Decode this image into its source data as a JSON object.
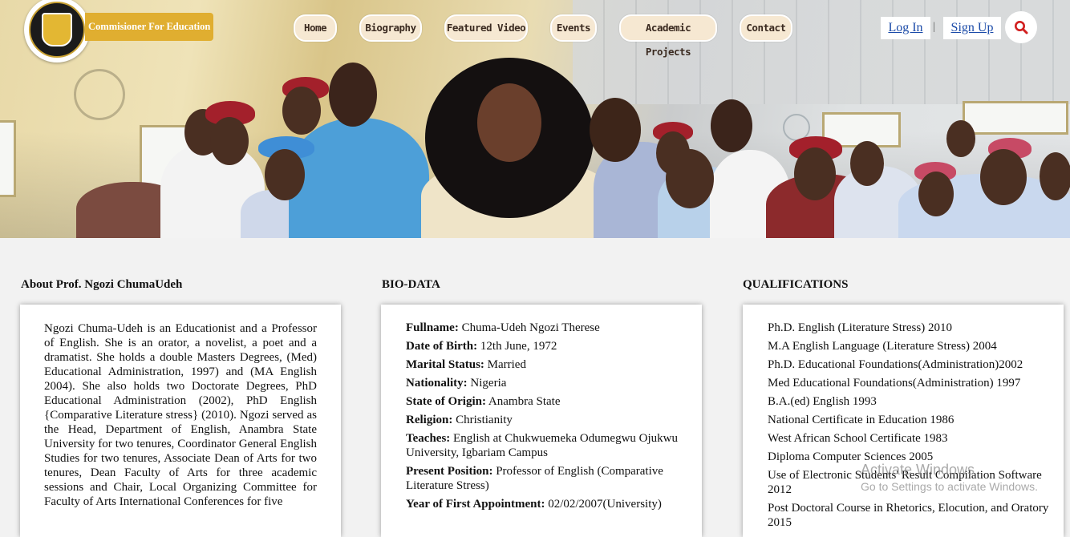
{
  "header": {
    "brand": "Commisioner For Education",
    "logo_alt": "Government of Anambra State Nigeria seal",
    "nav": [
      {
        "label": "Home"
      },
      {
        "label": "Biography"
      },
      {
        "label": "Featured Video"
      },
      {
        "label": "Events"
      },
      {
        "label": "Academic Projects"
      },
      {
        "label": "Contact"
      }
    ],
    "login": "Log In",
    "separator": "|",
    "signup": "Sign Up",
    "search_icon": "search-icon"
  },
  "about": {
    "title": "About Prof. Ngozi ChumaUdeh",
    "text": "Ngozi Chuma-Udeh is an Educationist and a Professor of English. She is an orator, a novelist, a poet and a dramatist. She holds a double Masters Degrees, (Med) Educational Administration, 1997) and (MA English 2004). She also holds two Doctorate Degrees, PhD Educational Administration (2002), PhD English {Comparative Literature stress} (2010). Ngozi served as the Head, Department of English, Anambra State University for two tenures, Coordinator General English Studies for two tenures, Associate Dean of Arts for two tenures, Dean Faculty of Arts for three academic sessions and Chair, Local Organizing Committee for Faculty of Arts International Conferences for five"
  },
  "biodata": {
    "title": "BIO-DATA",
    "items": [
      {
        "label": "Fullname:",
        "value": "Chuma-Udeh Ngozi Therese"
      },
      {
        "label": "Date of Birth:",
        "value": "12th June, 1972"
      },
      {
        "label": "Marital Status:",
        "value": "Married"
      },
      {
        "label": "Nationality:",
        "value": "Nigeria"
      },
      {
        "label": "State of Origin:",
        "value": "Anambra State"
      },
      {
        "label": "Religion:",
        "value": "Christianity"
      },
      {
        "label": "Teaches:",
        "value": "English at Chukwuemeka Odumegwu Ojukwu University, Igbariam Campus"
      },
      {
        "label": "Present Position:",
        "value": "Professor of English (Comparative Literature Stress)"
      },
      {
        "label": "Year of First Appointment:",
        "value": "02/02/2007(University)"
      }
    ]
  },
  "qualifications": {
    "title": "QUALIFICATIONS",
    "items": [
      "Ph.D. English (Literature Stress) 2010",
      "M.A English Language (Literature Stress) 2004",
      "Ph.D. Educational Foundations(Administration)2002",
      "Med Educational Foundations(Administration) 1997",
      "B.A.(ed) English 1993",
      "National Certificate in Education 1986",
      "West African School Certificate 1983",
      "Diploma Computer Sciences 2005",
      "Use of Electronic Students' Result Compilation Software 2012",
      "Post Doctoral Course in Rhetorics, Elocution, and Oratory 2015"
    ]
  },
  "watermark": {
    "line1": "Activate Windows",
    "line2": "Go to Settings to activate Windows."
  }
}
